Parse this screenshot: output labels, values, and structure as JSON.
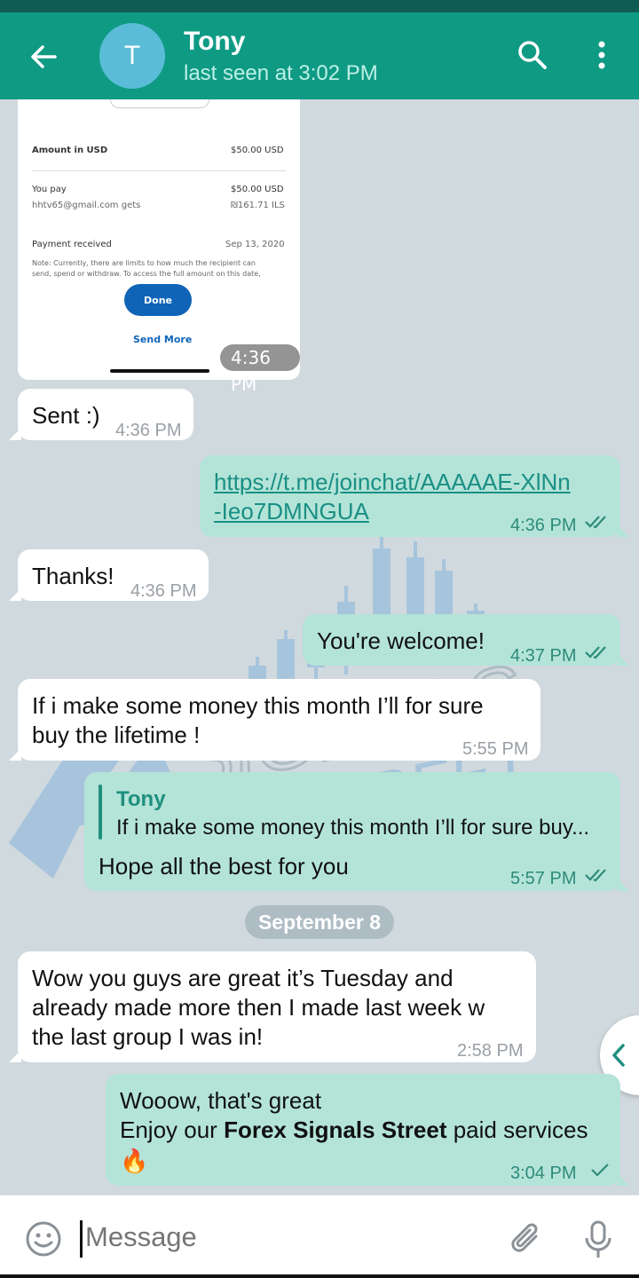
{
  "status_bar": {},
  "header": {
    "avatar_letter": "T",
    "title": "Tony",
    "subtitle": "last seen at 3:02 PM"
  },
  "receipt": {
    "amount_label": "Amount in USD",
    "amount_value": "$50.00 USD",
    "you_pay_label": "You pay",
    "you_pay_value": "$50.00 USD",
    "recipient_label": "hhtv65@gmail.com gets",
    "recipient_value": "₪161.71 ILS",
    "payment_received_label": "Payment received",
    "payment_received_value": "Sep 13, 2020",
    "note_line1": "Note: Currently, there are limits to how much the recipient can",
    "note_line2": "send, spend or withdraw. To access the full amount on this date,",
    "done_label": "Done",
    "send_more_label": "Send More",
    "time": "4:36 PM"
  },
  "messages": [
    {
      "dir": "in",
      "text": "Sent :)",
      "time": "4:36 PM"
    },
    {
      "dir": "out",
      "text_line1": "https://t.me/joinchat/AAAAAE-XlNn",
      "text_line2": "-Ieo7DMNGUA",
      "time": "4:36 PM",
      "status": "read"
    },
    {
      "dir": "in",
      "text": "Thanks!",
      "time": "4:36 PM"
    },
    {
      "dir": "out",
      "text": "You're welcome!",
      "time": "4:37 PM",
      "status": "read"
    },
    {
      "dir": "in",
      "text_line1": "If i make some money this month I’ll for sure",
      "text_line2": "buy the lifetime !",
      "time": "5:55 PM"
    },
    {
      "dir": "out",
      "reply_name": "Tony",
      "reply_text": "If i make some money this month I’ll for sure buy...",
      "text": "Hope all the best for you",
      "time": "5:57 PM",
      "status": "read"
    },
    {
      "dir": "in",
      "text_line1": "Wow you guys are great it’s Tuesday and",
      "text_line2": "already made more then I made last week w",
      "text_line3": "the last group I was in!",
      "time": "2:58 PM"
    },
    {
      "dir": "out",
      "text_line1": "Wooow, that's great",
      "text_pre": "Enjoy our ",
      "text_bold": "Forex Signals Street",
      "text_post": " paid services",
      "emoji": "🔥",
      "time": "3:04 PM",
      "status": "sent"
    }
  ],
  "date_chip": "September 8",
  "input": {
    "placeholder": "Message"
  },
  "colors": {
    "header": "#0f9a84",
    "status_bar": "#0f5d52",
    "outgoing": "#b4e4d8",
    "accent": "#1f8f7e"
  },
  "icons": [
    "back-arrow-icon",
    "search-icon",
    "more-vert-icon",
    "emoji-icon",
    "attach-icon",
    "mic-icon",
    "double-check-icon",
    "single-check-icon",
    "chevron-left-icon"
  ]
}
